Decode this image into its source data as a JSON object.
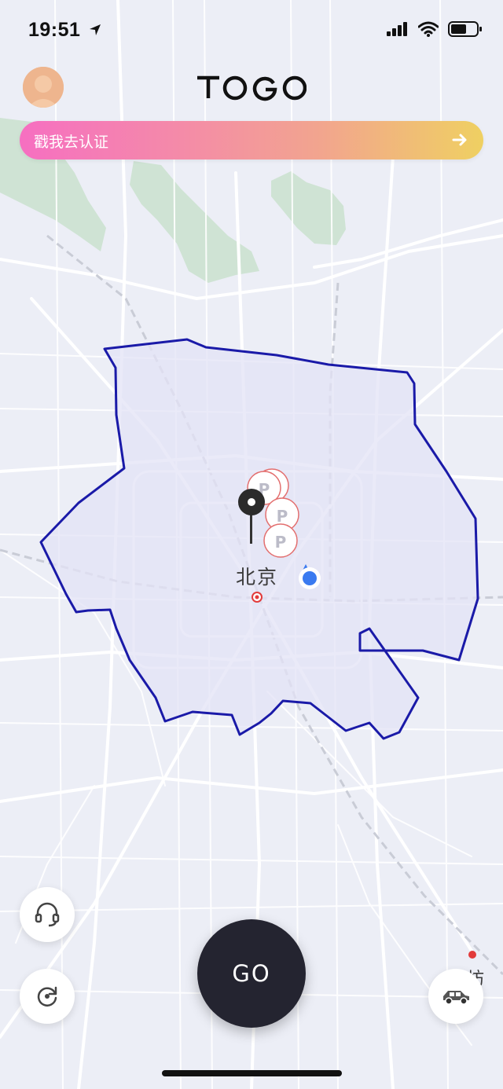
{
  "status_bar": {
    "time": "19:51"
  },
  "header": {
    "brand": "TOGO"
  },
  "banner": {
    "text": "戳我去认证"
  },
  "map": {
    "city_label": "北京",
    "city_label_partial": "坊",
    "parking_marker_letter": "P",
    "boundary_color": "#1a1aa8",
    "fill_color": "#e3e3f6",
    "green_area_color": "#cfe3d4"
  },
  "actions": {
    "go_label": "GO"
  },
  "icons": [
    "location-arrow-icon",
    "signal-icon",
    "wifi-icon",
    "battery-icon",
    "avatar",
    "arrow-right-icon",
    "parking-marker-icon",
    "pin-icon",
    "current-location-icon",
    "headset-icon",
    "refresh-icon",
    "car-icon"
  ]
}
